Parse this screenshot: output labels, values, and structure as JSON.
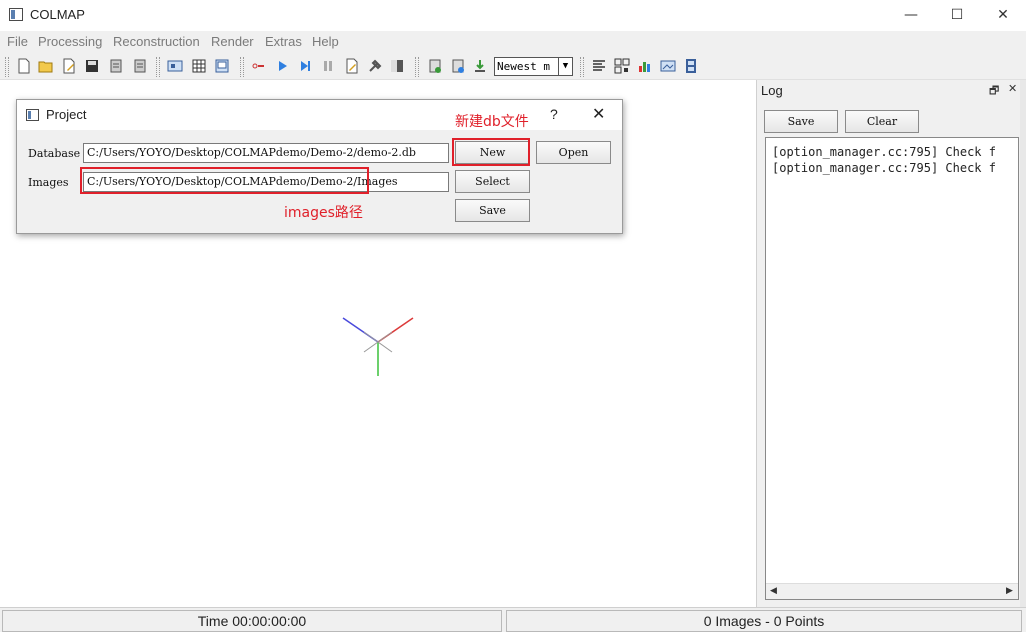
{
  "window": {
    "title": "COLMAP",
    "controls": {
      "minimize": "—",
      "maximize": "☐",
      "close": "✕"
    }
  },
  "menu": {
    "items": [
      "File",
      "Processing",
      "Reconstruction",
      "Render",
      "Extras",
      "Help"
    ]
  },
  "toolbar": {
    "icons": [
      "new-project-icon",
      "open-project-icon",
      "edit-project-icon",
      "save-project-icon",
      "import-model-icon",
      "export-model-icon",
      "feature-extraction-icon",
      "feature-matching-icon",
      "database-management-icon",
      "start-reconstruction-icon",
      "play-icon",
      "step-icon",
      "pause-icon",
      "reconstruction-options-icon",
      "bundle-adjustment-icon",
      "dense-reconstruction-icon",
      "render-options-icon",
      "render-point-icon",
      "render-camera-icon",
      "log-icon",
      "match-matrix-icon",
      "grab-image-icon",
      "grab-movie-icon",
      "film-icon"
    ],
    "select_value": "Newest m"
  },
  "dialog": {
    "title": "Project",
    "help": "?",
    "close": "✕",
    "database_label": "Database",
    "database_value": "C:/Users/YOYO/Desktop/COLMAPdemo/Demo-2/demo-2.db",
    "images_label": "Images",
    "images_value": "C:/Users/YOYO/Desktop/COLMAPdemo/Demo-2/Images",
    "new_label": "New",
    "open_label": "Open",
    "select_label": "Select",
    "save_label": "Save"
  },
  "annotations": {
    "new_db": "新建db文件",
    "images_path": "images路径",
    "color": "#e0202a"
  },
  "log": {
    "title": "Log",
    "save_label": "Save",
    "clear_label": "Clear",
    "lines": [
      "[option_manager.cc:795] Check f",
      "[option_manager.cc:795] Check f"
    ]
  },
  "status": {
    "time": "Time 00:00:00:00",
    "counts": "0 Images - 0 Points"
  }
}
